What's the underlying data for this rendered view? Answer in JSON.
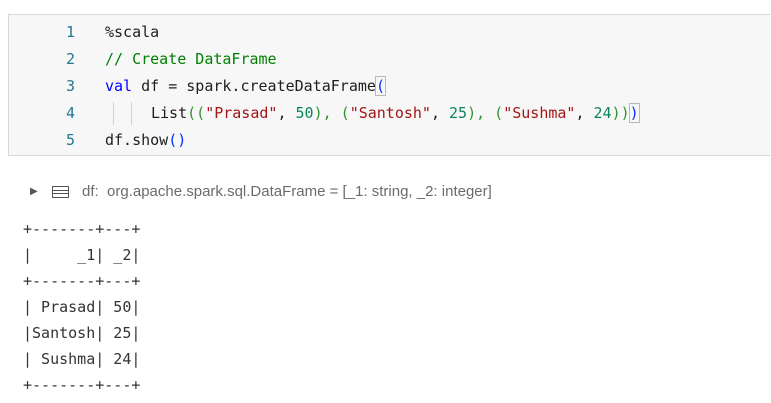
{
  "editor": {
    "lines": [
      {
        "num": "1",
        "tokens": [
          {
            "t": "%scala",
            "c": "plain"
          }
        ]
      },
      {
        "num": "2",
        "tokens": [
          {
            "t": "// Create DataFrame",
            "c": "comment"
          }
        ]
      },
      {
        "num": "3",
        "tokens": [
          {
            "t": "val",
            "c": "keyword"
          },
          {
            "t": " df = spark.createDataFrame",
            "c": "plain"
          },
          {
            "t": "(",
            "c": "paren1 bracket-hl"
          }
        ]
      },
      {
        "num": "4",
        "indent_guides": 2,
        "tokens": [
          {
            "t": "List",
            "c": "plain"
          },
          {
            "t": "((",
            "c": "paren2"
          },
          {
            "t": "\"Prasad\"",
            "c": "string"
          },
          {
            "t": ", ",
            "c": "plain"
          },
          {
            "t": "50",
            "c": "number"
          },
          {
            "t": "), (",
            "c": "paren2"
          },
          {
            "t": "\"Santosh\"",
            "c": "string"
          },
          {
            "t": ", ",
            "c": "plain"
          },
          {
            "t": "25",
            "c": "number"
          },
          {
            "t": "), (",
            "c": "paren2"
          },
          {
            "t": "\"Sushma\"",
            "c": "string"
          },
          {
            "t": ", ",
            "c": "plain"
          },
          {
            "t": "24",
            "c": "number"
          },
          {
            "t": "))",
            "c": "paren2"
          },
          {
            "t": ")",
            "c": "paren1 bracket-hl"
          }
        ]
      },
      {
        "num": "5",
        "tokens": [
          {
            "t": "df.show",
            "c": "plain"
          },
          {
            "t": "()",
            "c": "paren1"
          }
        ]
      }
    ]
  },
  "output": {
    "summary": "df:  org.apache.spark.sql.DataFrame = [_1: string, _2: integer]",
    "caret_icon": "caret-right-icon",
    "table_icon": "table-icon",
    "stdout": "+-------+---+\n|     _1| _2|\n+-------+---+\n| Prasad| 50|\n|Santosh| 25|\n| Sushma| 24|\n+-------+---+"
  },
  "colors": {
    "comment": "#008000",
    "keyword": "#0000ff",
    "string": "#a31515",
    "number": "#098658",
    "line_number": "#237893"
  }
}
